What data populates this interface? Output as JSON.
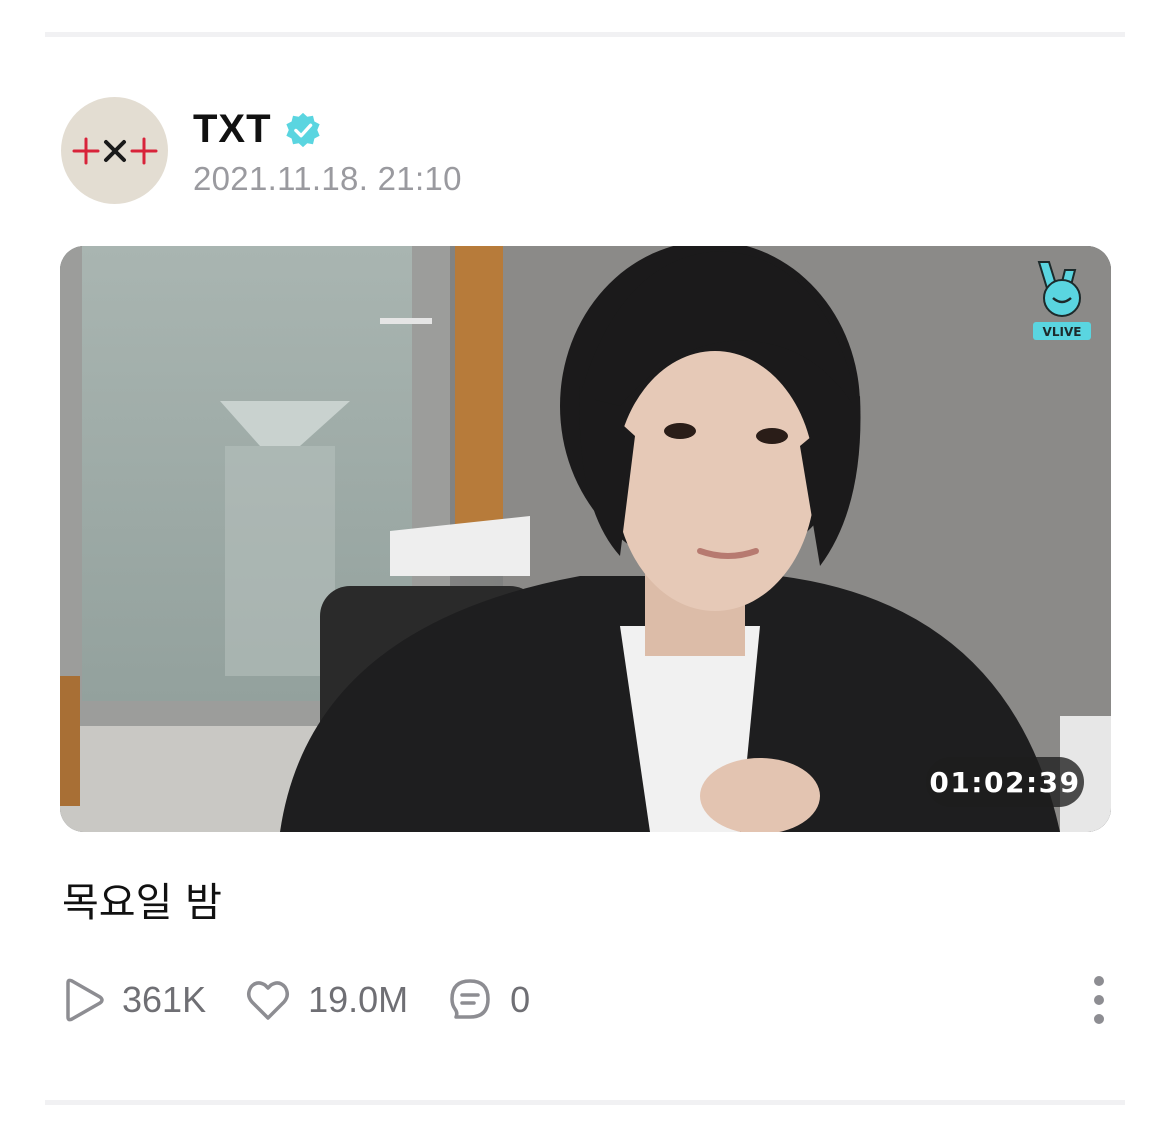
{
  "post": {
    "author": {
      "name": "TXT",
      "verified": true,
      "avatar_icon": "txt-logo-icon",
      "avatar_bg": "#e3ddd2"
    },
    "date": "2021.11.18. 21:10",
    "video": {
      "duration": "01:02:39",
      "watermark": "VLIVE",
      "watermark_color": "#5ad5e0"
    },
    "title": "목요일 밤",
    "stats": {
      "plays": "361K",
      "likes": "19.0M",
      "comments": "0"
    },
    "more_icon": "more-vertical-icon"
  },
  "colors": {
    "verified": "#5ad5e0",
    "muted_text": "#9a9a9f",
    "stat_text": "#6f6f74",
    "divider": "#f1f1f3"
  }
}
